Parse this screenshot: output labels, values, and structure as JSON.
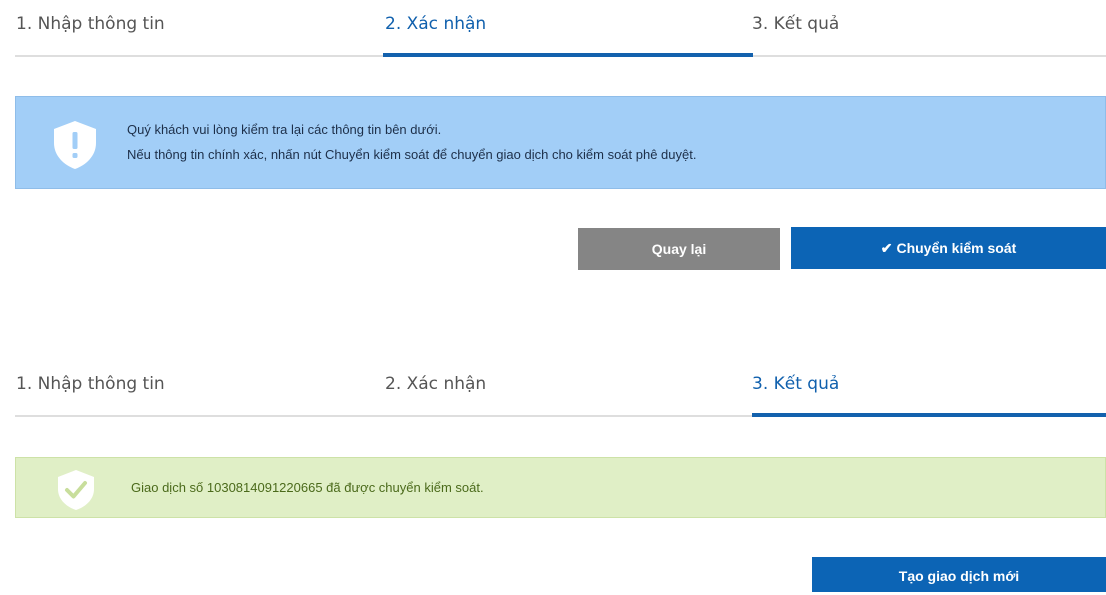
{
  "confirm_step": {
    "steps": [
      "1. Nhập thông tin",
      "2. Xác nhận",
      "3. Kết quả"
    ],
    "active_step_index": 1,
    "info_alert": {
      "icon": "shield-exclamation-icon",
      "line1": "Quý khách vui lòng kiểm tra lại các thông tin bên dưới.",
      "line2": "Nếu thông tin chính xác, nhấn nút Chuyển kiểm soát để chuyển giao dịch cho kiểm soát phê duyệt."
    },
    "back_button": "Quay lại",
    "submit_button": {
      "icon": "check-icon",
      "icon_glyph": "✔",
      "label": "Chuyển kiểm soát"
    }
  },
  "result_step": {
    "steps": [
      "1. Nhập thông tin",
      "2. Xác nhận",
      "3. Kết quả"
    ],
    "active_step_index": 2,
    "success_alert": {
      "icon": "shield-check-icon",
      "message": "Giao dịch số 1030814091220665 đã được chuyển kiểm soát."
    },
    "new_transaction_button": "Tạo giao dịch mới"
  },
  "colors": {
    "accent": "#1361ad",
    "info_bg": "#a2cef7",
    "success_bg": "#e0efc6",
    "back_button_bg": "#858585",
    "primary_button_bg": "#0c64b5"
  }
}
